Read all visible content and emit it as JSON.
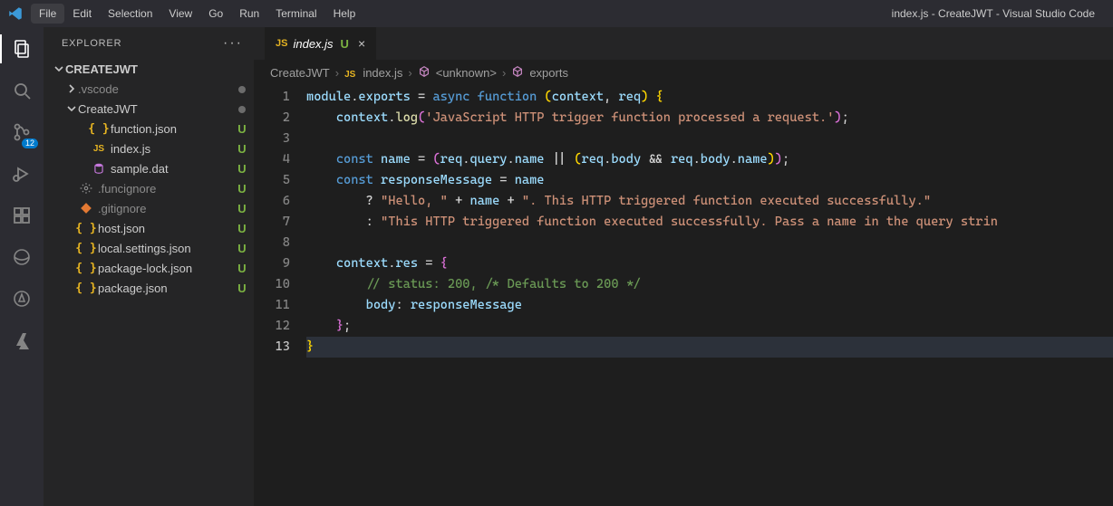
{
  "window_title": "index.js - CreateJWT - Visual Studio Code",
  "menu": {
    "items": [
      "File",
      "Edit",
      "Selection",
      "View",
      "Go",
      "Run",
      "Terminal",
      "Help"
    ],
    "active": "File"
  },
  "activity": {
    "scm_badge": "12"
  },
  "explorer": {
    "title": "EXPLORER",
    "root": "CREATEJWT",
    "tree": [
      {
        "kind": "folder",
        "name": ".vscode",
        "expanded": false,
        "depth": 1,
        "status": "dot",
        "dim": true
      },
      {
        "kind": "folder",
        "name": "CreateJWT",
        "expanded": true,
        "depth": 1,
        "status": "dot"
      },
      {
        "kind": "file",
        "name": "function.json",
        "icon": "braces",
        "iconColor": "c-yellow",
        "depth": 2,
        "status": "U",
        "statusColor": "c-green"
      },
      {
        "kind": "file",
        "name": "index.js",
        "icon": "js",
        "iconColor": "c-yellow",
        "depth": 2,
        "status": "U",
        "statusColor": "c-green"
      },
      {
        "kind": "file",
        "name": "sample.dat",
        "icon": "db",
        "iconColor": "c-purple",
        "depth": 2,
        "status": "U",
        "statusColor": "c-green"
      },
      {
        "kind": "file",
        "name": ".funcignore",
        "icon": "gear",
        "iconColor": "c-gray",
        "depth": 1,
        "status": "U",
        "statusColor": "c-green",
        "dim": true
      },
      {
        "kind": "file",
        "name": ".gitignore",
        "icon": "git",
        "iconColor": "c-orange",
        "depth": 1,
        "status": "U",
        "statusColor": "c-green",
        "dim": true
      },
      {
        "kind": "file",
        "name": "host.json",
        "icon": "braces",
        "iconColor": "c-yellow",
        "depth": 1,
        "status": "U",
        "statusColor": "c-green"
      },
      {
        "kind": "file",
        "name": "local.settings.json",
        "icon": "braces",
        "iconColor": "c-yellow",
        "depth": 1,
        "status": "U",
        "statusColor": "c-green"
      },
      {
        "kind": "file",
        "name": "package-lock.json",
        "icon": "braces",
        "iconColor": "c-yellow",
        "depth": 1,
        "status": "U",
        "statusColor": "c-green"
      },
      {
        "kind": "file",
        "name": "package.json",
        "icon": "braces",
        "iconColor": "c-yellow",
        "depth": 1,
        "status": "U",
        "statusColor": "c-green"
      }
    ]
  },
  "tab": {
    "label": "index.js",
    "flag": "U"
  },
  "breadcrumbs": {
    "parts": [
      "CreateJWT",
      "index.js",
      "<unknown>",
      "exports"
    ]
  },
  "code": {
    "line_start": 1,
    "line_end": 13,
    "lines": [
      [
        [
          "id",
          "module"
        ],
        [
          "p",
          "."
        ],
        [
          "id",
          "exports"
        ],
        [
          "p",
          " = "
        ],
        [
          "kw",
          "async"
        ],
        [
          "p",
          " "
        ],
        [
          "kw",
          "function"
        ],
        [
          "p",
          " "
        ],
        [
          "br",
          "("
        ],
        [
          "id",
          "context"
        ],
        [
          "p",
          ", "
        ],
        [
          "id",
          "req"
        ],
        [
          "br",
          ")"
        ],
        [
          "p",
          " "
        ],
        [
          "br",
          "{"
        ]
      ],
      [
        [
          "p",
          "    "
        ],
        [
          "id",
          "context"
        ],
        [
          "p",
          "."
        ],
        [
          "fn",
          "log"
        ],
        [
          "br2",
          "("
        ],
        [
          "str",
          "'JavaScript HTTP trigger function processed a request.'"
        ],
        [
          "br2",
          ")"
        ],
        [
          "p",
          ";"
        ]
      ],
      [],
      [
        [
          "p",
          "    "
        ],
        [
          "kw",
          "const"
        ],
        [
          "p",
          " "
        ],
        [
          "id",
          "name"
        ],
        [
          "p",
          " = "
        ],
        [
          "br2",
          "("
        ],
        [
          "id",
          "req"
        ],
        [
          "p",
          "."
        ],
        [
          "id",
          "query"
        ],
        [
          "p",
          "."
        ],
        [
          "id",
          "name"
        ],
        [
          "p",
          " || "
        ],
        [
          "br",
          "("
        ],
        [
          "id",
          "req"
        ],
        [
          "p",
          "."
        ],
        [
          "id",
          "body"
        ],
        [
          "p",
          " && "
        ],
        [
          "id",
          "req"
        ],
        [
          "p",
          "."
        ],
        [
          "id",
          "body"
        ],
        [
          "p",
          "."
        ],
        [
          "id",
          "name"
        ],
        [
          "br",
          ")"
        ],
        [
          "br2",
          ")"
        ],
        [
          "p",
          ";"
        ]
      ],
      [
        [
          "p",
          "    "
        ],
        [
          "kw",
          "const"
        ],
        [
          "p",
          " "
        ],
        [
          "id",
          "responseMessage"
        ],
        [
          "p",
          " = "
        ],
        [
          "id",
          "name"
        ]
      ],
      [
        [
          "p",
          "        ? "
        ],
        [
          "str",
          "\"Hello, \""
        ],
        [
          "p",
          " + "
        ],
        [
          "id",
          "name"
        ],
        [
          "p",
          " + "
        ],
        [
          "str",
          "\". This HTTP triggered function executed successfully.\""
        ]
      ],
      [
        [
          "p",
          "        : "
        ],
        [
          "str",
          "\"This HTTP triggered function executed successfully. Pass a name in the query strin"
        ]
      ],
      [],
      [
        [
          "p",
          "    "
        ],
        [
          "id",
          "context"
        ],
        [
          "p",
          "."
        ],
        [
          "id",
          "res"
        ],
        [
          "p",
          " = "
        ],
        [
          "br2",
          "{"
        ]
      ],
      [
        [
          "p",
          "        "
        ],
        [
          "cmt",
          "// status: 200, /* Defaults to 200 */"
        ]
      ],
      [
        [
          "p",
          "        "
        ],
        [
          "id",
          "body"
        ],
        [
          "p",
          ":"
        ],
        [
          "p",
          " "
        ],
        [
          "id",
          "responseMessage"
        ]
      ],
      [
        [
          "p",
          "    "
        ],
        [
          "br2",
          "}"
        ],
        [
          "p",
          ";"
        ]
      ],
      [
        [
          "br",
          "}"
        ]
      ]
    ],
    "current_line": 13
  }
}
